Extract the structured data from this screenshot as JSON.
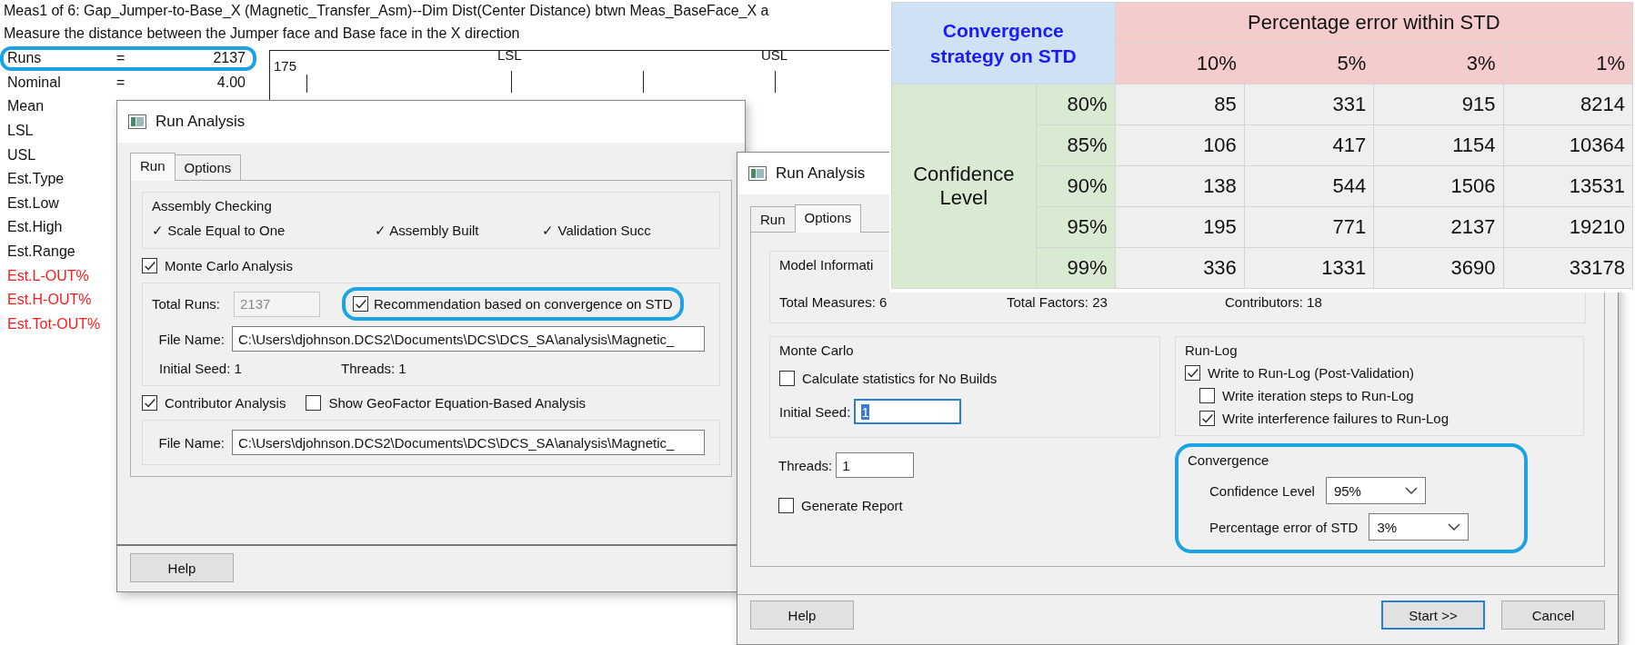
{
  "report": {
    "title": "Meas1 of 6: Gap_Jumper-to-Base_X (Magnetic_Transfer_Asm)--Dim Dist(Center Distance) btwn Meas_BaseFace_X a",
    "description": "Measure the distance between the Jumper face and Base face in the X direction",
    "stats": [
      {
        "label": "Runs",
        "sign": "=",
        "value": "2137",
        "alert": false,
        "highlighted": true
      },
      {
        "label": "Nominal",
        "sign": "=",
        "value": "4.00",
        "alert": false,
        "highlighted": false
      },
      {
        "label": "Mean",
        "alert": false,
        "highlighted": false
      },
      {
        "label": "LSL",
        "alert": false,
        "highlighted": false
      },
      {
        "label": "USL",
        "alert": false,
        "highlighted": false
      },
      {
        "label": "Est.Type",
        "alert": false,
        "highlighted": false
      },
      {
        "label": "Est.Low",
        "alert": false,
        "highlighted": false
      },
      {
        "label": "Est.High",
        "alert": false,
        "highlighted": false
      },
      {
        "label": "Est.Range",
        "alert": false,
        "highlighted": false
      },
      {
        "label": "Est.L-OUT%",
        "alert": true,
        "highlighted": false
      },
      {
        "label": "Est.H-OUT%",
        "alert": true,
        "highlighted": false
      },
      {
        "label": "Est.Tot-OUT%",
        "alert": true,
        "highlighted": false
      }
    ],
    "chart": {
      "y_tick": "175",
      "limits": [
        "LSL",
        "USL"
      ]
    }
  },
  "run_dialog": {
    "title": "Run Analysis",
    "tabs": [
      {
        "label": "Run",
        "selected": true
      },
      {
        "label": "Options",
        "selected": false
      }
    ],
    "assembly_checking": {
      "title": "Assembly Checking",
      "checks": [
        "✓ Scale Equal to One",
        "✓ Assembly Built",
        "✓ Validation Succ"
      ]
    },
    "monte_carlo": {
      "label": "Monte Carlo Analysis",
      "checked": true,
      "total_runs_label": "Total Runs:",
      "total_runs": "2137",
      "total_runs_disabled": true,
      "recommendation": {
        "label": "Recommendation based on convergence on STD",
        "checked": true,
        "highlighted": true
      },
      "file_label": "File Name:",
      "file": "C:\\Users\\djohnson.DCS2\\Documents\\DCS\\DCS_SA\\analysis\\Magnetic_",
      "initial_seed": "Initial Seed: 1",
      "threads": "Threads: 1"
    },
    "contributor": {
      "label": "Contributor Analysis",
      "checked": true,
      "geofactor": {
        "label": "Show GeoFactor Equation-Based Analysis",
        "checked": false
      },
      "file_label": "File Name:",
      "file": "C:\\Users\\djohnson.DCS2\\Documents\\DCS\\DCS_SA\\analysis\\Magnetic_"
    },
    "buttons": [
      {
        "label": "Help",
        "default": false
      }
    ]
  },
  "options_dialog": {
    "title": "Run Analysis",
    "tabs": [
      {
        "label": "Run",
        "selected": false
      },
      {
        "label": "Options",
        "selected": true
      }
    ],
    "model_information": {
      "title": "Model Informati",
      "items": [
        "Total Measures: 6",
        "Total Factors: 23",
        "Contributors: 18"
      ]
    },
    "monte_carlo": {
      "title": "Monte Carlo",
      "no_builds": {
        "label": "Calculate statistics for No Builds",
        "checked": false
      },
      "initial_seed_label": "Initial Seed:",
      "initial_seed": "1",
      "initial_seed_focused": true
    },
    "threads_label": "Threads:",
    "threads": "1",
    "generate_report": {
      "label": "Generate Report",
      "checked": false
    },
    "run_log": {
      "title": "Run-Log",
      "options": [
        {
          "label": "Write to Run-Log (Post-Validation)",
          "checked": true,
          "children": [
            {
              "label": "Write iteration steps to Run-Log",
              "checked": false
            },
            {
              "label": "Write interference failures to Run-Log",
              "checked": true
            }
          ]
        }
      ]
    },
    "convergence": {
      "title": "Convergence",
      "highlighted": true,
      "confidence_label": "Confidence Level",
      "confidence": "95%",
      "error_label": "Percentage error of STD",
      "error": "3%"
    },
    "buttons": [
      {
        "label": "Help",
        "default": false
      },
      {
        "label": "Start >>",
        "default": true
      },
      {
        "label": "Cancel",
        "default": false
      }
    ]
  },
  "table": {
    "corner": "Convergence strategy on STD",
    "column_group": "Percentage error within STD",
    "columns": [
      "10%",
      "5%",
      "3%",
      "1%"
    ],
    "row_group": "Confidence Level",
    "rows": [
      {
        "label": "80%",
        "values": [
          "85",
          "331",
          "915",
          "8214"
        ]
      },
      {
        "label": "85%",
        "values": [
          "106",
          "417",
          "1154",
          "10364"
        ]
      },
      {
        "label": "90%",
        "values": [
          "138",
          "544",
          "1506",
          "13531"
        ]
      },
      {
        "label": "95%",
        "values": [
          "195",
          "771",
          "2137",
          "19210"
        ]
      },
      {
        "label": "99%",
        "values": [
          "336",
          "1331",
          "3690",
          "33178"
        ]
      }
    ]
  }
}
